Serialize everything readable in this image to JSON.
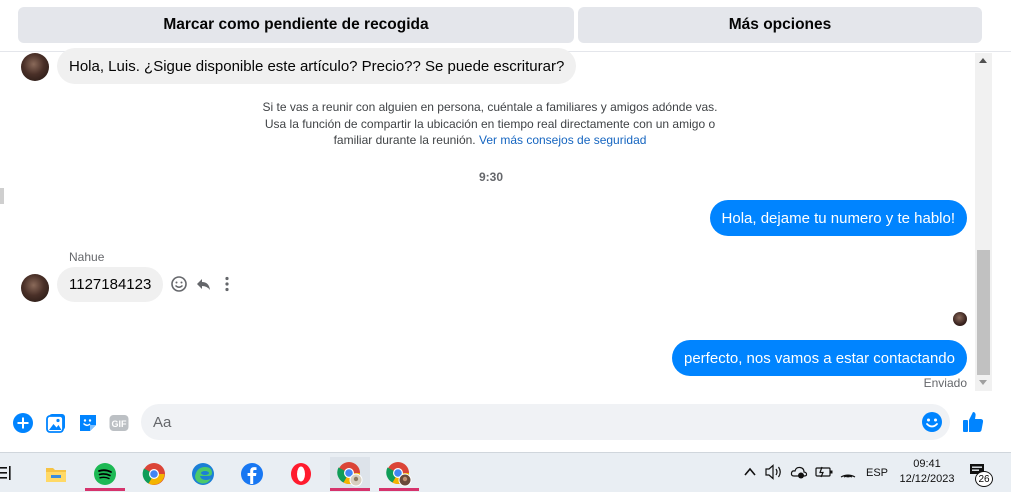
{
  "header": {
    "mark_pending_label": "Marcar como pendiente de recogida",
    "more_options_label": "Más opciones"
  },
  "chat": {
    "messages": [
      {
        "direction": "in",
        "text": "Hola, Luis. ¿Sigue disponible este artículo?  Precio?? Se puede escriturar?"
      },
      {
        "direction": "out",
        "text": "Hola, dejame tu numero y te hablo!"
      },
      {
        "direction": "in",
        "sender": "Nahue",
        "text": "1127184123"
      },
      {
        "direction": "out",
        "text": "perfecto, nos vamos a estar contactando"
      }
    ],
    "safety_notice_line1": "Si te vas a reunir con alguien en persona, cuéntale a familiares y amigos adónde vas.",
    "safety_notice_line2": "Usa la función de compartir la ubicación en tiempo real directamente con un amigo o",
    "safety_notice_line3": "familiar durante la reunión.",
    "safety_link": "Ver más consejos de seguridad",
    "time_separator": "9:30",
    "status": "Enviado"
  },
  "composer": {
    "placeholder": "Aa",
    "icons": [
      "plus-icon",
      "photo-icon",
      "sticker-icon",
      "gif-icon",
      "emoji-icon",
      "like-icon"
    ],
    "gif_label": "GIF"
  },
  "taskbar": {
    "apps": [
      "file-explorer-icon",
      "spotify-icon",
      "chrome-icon",
      "edge-icon",
      "facebook-icon",
      "opera-icon",
      "chrome-profile-icon",
      "chrome-profile-2-icon"
    ],
    "language": "ESP",
    "time": "09:41",
    "date": "12/12/2023",
    "notifications_count": "26"
  },
  "colors": {
    "accent": "#0084ff",
    "bubble_in": "#f0f0f0",
    "button_bg": "#e4e6eb"
  }
}
